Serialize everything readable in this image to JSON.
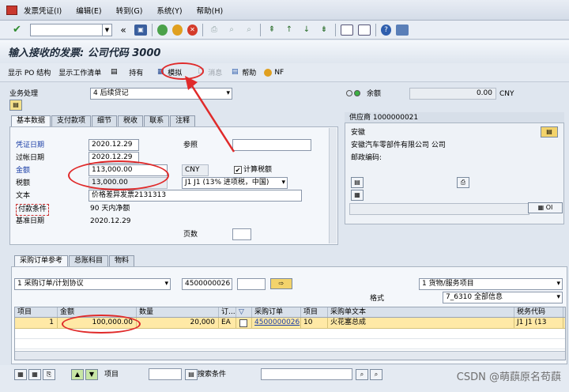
{
  "menu": {
    "items": [
      "发票凭证(I)",
      "编辑(E)",
      "转到(G)",
      "系统(Y)",
      "帮助(H)"
    ]
  },
  "title": "输入接收的发票: 公司代码 3000",
  "app_toolbar": {
    "show_po_structure": "显示 PO 结构",
    "show_worklist": "显示工作清单",
    "hold": "持有",
    "simulate": "模拟",
    "messages": "消息",
    "help": "帮助",
    "nf": "NF"
  },
  "header": {
    "transaction_label": "业务处理",
    "transaction_value": "4 后续贷记",
    "balance_label": "余额",
    "balance_value": "0.00",
    "balance_currency": "CNY"
  },
  "tabs": [
    "基本数据",
    "支付款项",
    "细节",
    "税收",
    "联系",
    "注释"
  ],
  "basic_data": {
    "invoice_date_label": "凭证日期",
    "invoice_date": "2020.12.29",
    "reference_label": "参照",
    "posting_date_label": "过帐日期",
    "posting_date": "2020.12.29",
    "amount_label": "金额",
    "amount": "113,000.00",
    "currency": "CNY",
    "calc_tax_label": "计算税额",
    "tax_amount_label": "税额",
    "tax_amount": "13,000.00",
    "tax_code": "J1 J1 (13% 进项税，中国)",
    "text_label": "文本",
    "text_value": "价格差异发票2131313",
    "payment_terms_label": "付款条件",
    "payment_terms_value": "90 天内净额",
    "baseline_date_label": "基准日期",
    "baseline_date": "2020.12.29",
    "pages_label": "页数"
  },
  "vendor": {
    "title": "供应商 1000000021",
    "city": "安徽",
    "name": "安徽汽车零部件有限公司 公司",
    "postal_label": "邮政编码:",
    "oi": "OI"
  },
  "po_tabs": [
    "采购订单参考",
    "总账科目",
    "物料"
  ],
  "po_ref": {
    "reference_type": "1 采购订单/计划协议",
    "po_number": "4500000026",
    "layout_label": "格式",
    "item_type": "1 货物/服务项目",
    "layout_value": "7_6310 全部信息"
  },
  "grid": {
    "columns": [
      "项目",
      "金额",
      "数量",
      "订...",
      "",
      "采购订单",
      "项目",
      "采购单文本",
      "税务代码"
    ],
    "rows": [
      [
        "1",
        "100,000.00",
        "20,000",
        "EA",
        "",
        "4500000026",
        "10",
        "火花塞总成",
        "J1  J1 (13"
      ]
    ]
  },
  "bottom": {
    "item_label": "项目",
    "search_label": "搜索条件",
    "watermark": "CSDN @萌蕻原名苟蕻"
  }
}
